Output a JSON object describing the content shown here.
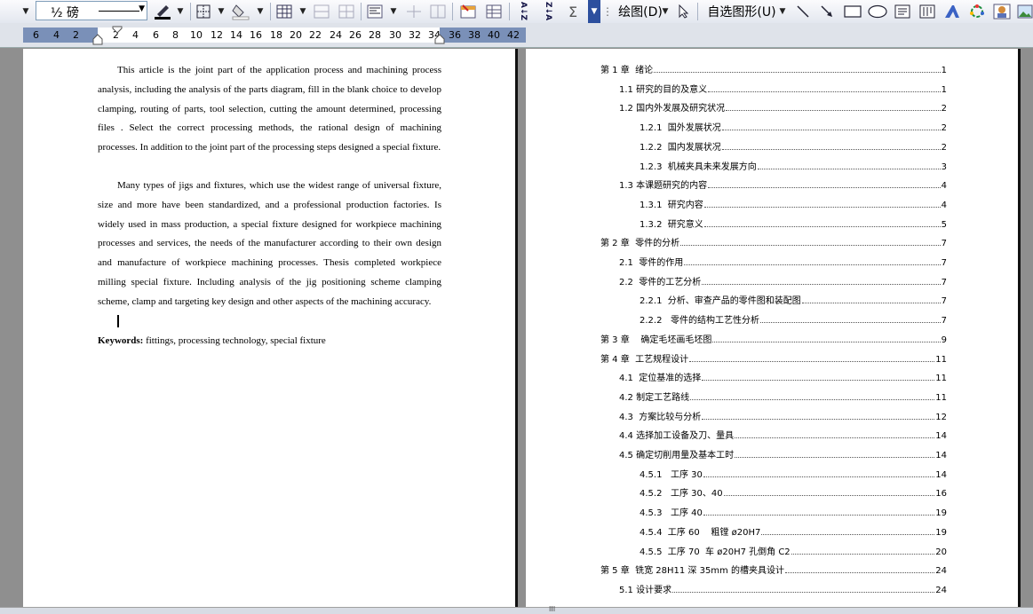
{
  "toolbar": {
    "line_weight": "½ 磅",
    "draw_menu": "绘图(D)",
    "autoshape_menu": "自选图形(U)",
    "sigma_symbol": "Σ",
    "sort_asc_label": "A↓Z",
    "sort_desc_label": "Z↓A"
  },
  "ruler": {
    "ticks": [
      "6",
      "4",
      "2",
      "2",
      "4",
      "6",
      "8",
      "10",
      "12",
      "14",
      "16",
      "18",
      "20",
      "22",
      "24",
      "26",
      "28",
      "30",
      "32",
      "34",
      "36",
      "38",
      "40",
      "42"
    ]
  },
  "left_page": {
    "para1": "This article is the joint part of the application process and machining process analysis, including the analysis of the parts diagram, fill in the blank choice to develop clamping, routing of parts, tool selection, cutting the amount determined, processing files . Select the correct processing methods, the rational design of machining processes. In addition to the joint part of the processing steps designed a special fixture.",
    "para2": "Many types of jigs and fixtures, which use the widest range of universal fixture, size and more have been standardized, and a professional production factories. Is widely used in mass production, a special fixture designed for workpiece machining processes and services, the needs of the manufacturer according to their own design and manufacture of workpiece machining processes. Thesis completed workpiece milling special fixture. Including analysis of the jig positioning scheme clamping scheme, clamp and targeting key design and other aspects of the machining accuracy.",
    "keywords_label": "Keywords:",
    "keywords_text": " fittings, processing technology, special fixture"
  },
  "toc": [
    {
      "title": "第 1 章  绪论",
      "page": "1",
      "level": 1
    },
    {
      "title": "1.1 研究的目的及意义",
      "page": "1",
      "level": 2
    },
    {
      "title": "1.2 国内外发展及研究状况",
      "page": "2",
      "level": 2
    },
    {
      "title": "1.2.1  国外发展状况",
      "page": "2",
      "level": 3
    },
    {
      "title": "1.2.2  国内发展状况",
      "page": "2",
      "level": 3
    },
    {
      "title": "1.2.3  机械夹具未来发展方向",
      "page": "3",
      "level": 3
    },
    {
      "title": "1.3 本课题研究的内容",
      "page": "4",
      "level": 2
    },
    {
      "title": "1.3.1  研究内容",
      "page": "4",
      "level": 3
    },
    {
      "title": "1.3.2  研究意义",
      "page": "5",
      "level": 3
    },
    {
      "title": "第 2 章  零件的分析",
      "page": "7",
      "level": 1
    },
    {
      "title": "2.1  零件的作用",
      "page": "7",
      "level": 2
    },
    {
      "title": "2.2  零件的工艺分析",
      "page": "7",
      "level": 2
    },
    {
      "title": "2.2.1  分析、审查产品的零件图和装配图",
      "page": "7",
      "level": 3
    },
    {
      "title": "2.2.2   零件的结构工艺性分析",
      "page": "7",
      "level": 3
    },
    {
      "title": "第 3 章    确定毛坯画毛坯图",
      "page": "9",
      "level": 1
    },
    {
      "title": "第 4 章  工艺规程设计",
      "page": "11",
      "level": 1
    },
    {
      "title": "4.1  定位基准的选择",
      "page": "11",
      "level": 2
    },
    {
      "title": "4.2 制定工艺路线",
      "page": "11",
      "level": 2
    },
    {
      "title": "4.3  方案比较与分析",
      "page": "12",
      "level": 2
    },
    {
      "title": "4.4 选择加工设备及刀、量具",
      "page": "14",
      "level": 2
    },
    {
      "title": "4.5 确定切削用量及基本工时",
      "page": "14",
      "level": 2
    },
    {
      "title": "4.5.1   工序 30",
      "page": "14",
      "level": 3
    },
    {
      "title": "4.5.2   工序 30、40",
      "page": "16",
      "level": 3
    },
    {
      "title": "4.5.3   工序 40",
      "page": "19",
      "level": 3
    },
    {
      "title": "4.5.4  工序 60    粗镗 ø20H7",
      "page": "19",
      "level": 3
    },
    {
      "title": "4.5.5  工序 70  车 ø20H7 孔倒角 C2",
      "page": "20",
      "level": 3
    },
    {
      "title": "第 5 章  铣宽 28H11 深 35mm 的槽夹具设计",
      "page": "24",
      "level": 1
    },
    {
      "title": "5.1 设计要求",
      "page": "24",
      "level": 2
    }
  ],
  "status": {
    "scroll_grip": "III"
  }
}
